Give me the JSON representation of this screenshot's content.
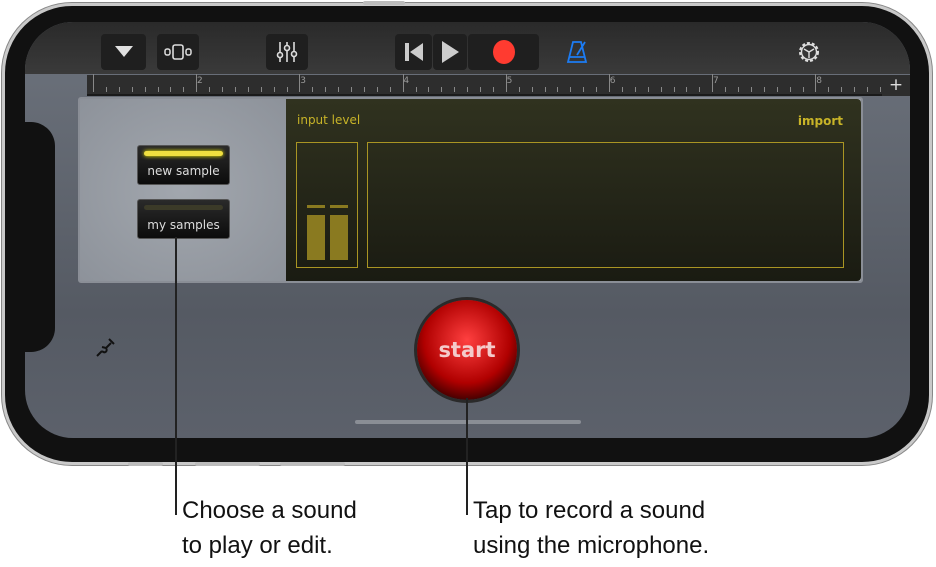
{
  "toolbar": {
    "icons": [
      "triangle-down",
      "view-toggle",
      "mixer",
      "rewind",
      "play",
      "record",
      "metronome",
      "settings-gear"
    ],
    "accent": "#1c7cf4",
    "record_color": "#ff3b30"
  },
  "ruler": {
    "bars": [
      "2",
      "3",
      "4",
      "5",
      "6",
      "7",
      "8"
    ],
    "add_label": "+"
  },
  "sampler": {
    "new_sample": "new sample",
    "my_samples": "my samples",
    "input_level": "input level",
    "import": "import",
    "display_color": "#c8b428"
  },
  "start_label": "start",
  "callouts": {
    "left": [
      "Choose a sound",
      "to play or edit."
    ],
    "right": [
      "Tap to record a sound",
      "using the microphone."
    ]
  }
}
